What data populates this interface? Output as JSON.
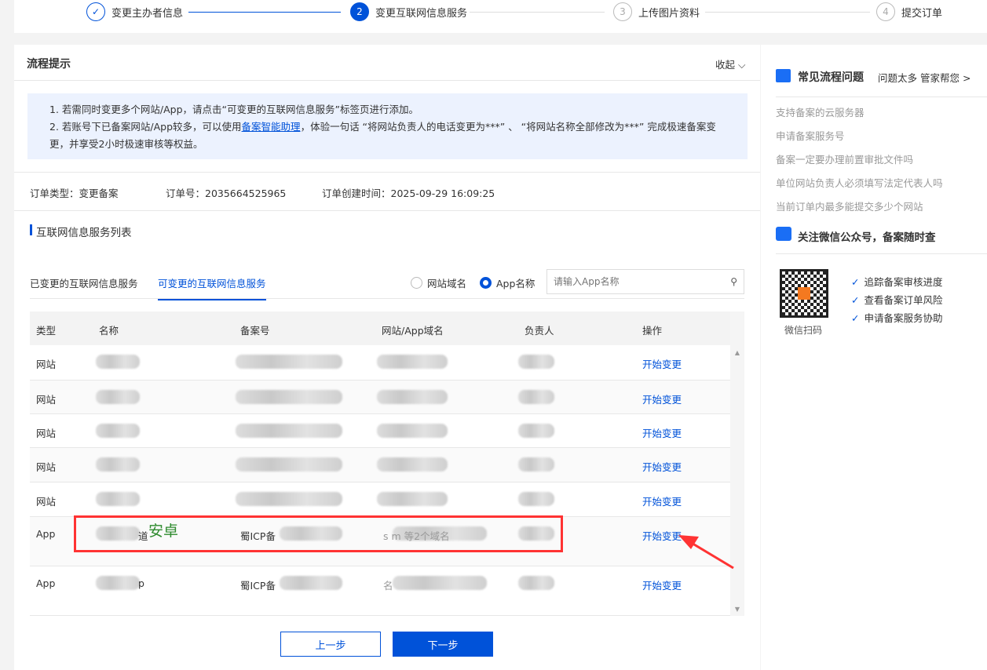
{
  "steps": [
    {
      "num": "✓",
      "label": "变更主办者信息",
      "state": "done"
    },
    {
      "num": "2",
      "label": "变更互联网信息服务",
      "state": "active"
    },
    {
      "num": "3",
      "label": "上传图片资料",
      "state": "todo"
    },
    {
      "num": "4",
      "label": "提交订单",
      "state": "todo"
    }
  ],
  "process": {
    "title": "流程提示",
    "collapse": "收起",
    "tip1": "1. 若需同时变更多个网站/App，请点击“可变更的互联网信息服务”标签页进行添加。",
    "tip2_pre": "2. 若账号下已备案网站/App较多，可以使用",
    "tip2_link": "备案智能助理",
    "tip2_post": "，体验一句话 “将网站负责人的电话变更为***” 、 “将网站名称全部修改为***” 完成极速备案变更，并享受2小时极速审核等权益。"
  },
  "order": {
    "type": "订单类型：变更备案",
    "number": "订单号：2035664525965",
    "created": "订单创建时间：2025-09-29 16:09:25"
  },
  "list": {
    "title": "互联网信息服务列表",
    "tabs": [
      {
        "label": "已变更的互联网信息服务"
      },
      {
        "label": "可变更的互联网信息服务",
        "active": true
      }
    ],
    "radio": [
      {
        "label": "网站域名",
        "checked": false
      },
      {
        "label": "App名称",
        "checked": true
      }
    ],
    "search_placeholder": "请输入App名称",
    "columns": [
      "类型",
      "名称",
      "备案号",
      "网站/App域名",
      "负责人",
      "操作"
    ],
    "rows": [
      {
        "type": "网站",
        "name": "",
        "icp": "",
        "domain": "",
        "action": "开始变更"
      },
      {
        "type": "网站",
        "name": "",
        "icp": "",
        "domain": "",
        "action": "开始变更"
      },
      {
        "type": "网站",
        "name": "",
        "icp": "",
        "domain": "",
        "action": "开始变更"
      },
      {
        "type": "网站",
        "name": "",
        "icp": "",
        "domain": "",
        "action": "开始变更"
      },
      {
        "type": "网站",
        "name": "",
        "icp": "",
        "domain": "",
        "action": "开始变更"
      },
      {
        "type": "App",
        "name": "道",
        "icp": "蜀ICP备",
        "domain": "s          m 等2个域名",
        "action": "开始变更"
      },
      {
        "type": "App",
        "name": "p",
        "icp": "蜀ICP备",
        "domain": "名",
        "action": "开始变更"
      }
    ]
  },
  "annotation": {
    "label": "安卓",
    "color": "#ff3333",
    "label_color": "#2e8b2e"
  },
  "buttons": {
    "prev": "上一步",
    "next": "下一步"
  },
  "side": {
    "faq_title": "常见流程问题",
    "faq_help": "问题太多 管家帮您",
    "faq": [
      "支持备案的云服务器",
      "申请备案服务号",
      "备案一定要办理前置审批文件吗",
      "单位网站负责人必须填写法定代表人吗",
      "当前订单内最多能提交多少个网站"
    ],
    "wechat_title": "关注微信公众号，备案随时查",
    "qr_caption": "微信扫码",
    "benefits": [
      "追踪备案审核进度",
      "查看备案订单风险",
      "申请备案服务协助"
    ]
  },
  "colors": {
    "primary": "#0052d9",
    "tip_bg": "#ecf2fe"
  }
}
